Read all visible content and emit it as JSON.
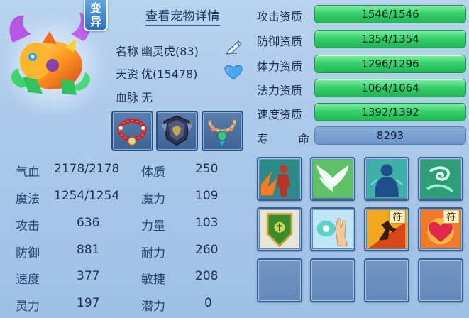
{
  "pet": {
    "variant_badge": [
      "变",
      "异"
    ],
    "detail_link": "查看宠物详情",
    "name_label": "名称",
    "name_value": "幽灵虎(83)",
    "talent_label": "天资",
    "talent_value": "优(15478)",
    "bloodline_label": "血脉",
    "bloodline_value": "无"
  },
  "equipment": [
    {
      "icon": "red-bead-collar-icon"
    },
    {
      "icon": "dark-armor-icon"
    },
    {
      "icon": "jade-necklace-icon"
    }
  ],
  "stats": {
    "hp_label": "气血",
    "hp_value": "2178/2178",
    "mp_label": "魔法",
    "mp_value": "1254/1254",
    "atk_label": "攻击",
    "atk_value": "636",
    "def_label": "防御",
    "def_value": "881",
    "spd_label": "速度",
    "spd_value": "377",
    "spi_label": "灵力",
    "spi_value": "197",
    "con_label": "体质",
    "con_value": "250",
    "mag_label": "魔力",
    "mag_value": "109",
    "str_label": "力量",
    "str_value": "103",
    "end_label": "耐力",
    "end_value": "260",
    "agi_label": "敏捷",
    "agi_value": "208",
    "pot_label": "潜力",
    "pot_value": "0"
  },
  "aptitudes": [
    {
      "label": "攻击资质",
      "value": "1546/1546",
      "fill": 1.0
    },
    {
      "label": "防御资质",
      "value": "1354/1354",
      "fill": 1.0
    },
    {
      "label": "体力资质",
      "value": "1296/1296",
      "fill": 1.0
    },
    {
      "label": "法力资质",
      "value": "1064/1064",
      "fill": 1.0
    },
    {
      "label": "速度资质",
      "value": "1392/1392",
      "fill": 1.0
    }
  ],
  "life": {
    "label_1": "寿",
    "label_2": "命",
    "value": "8293"
  },
  "skills": [
    {
      "icon": "body-flames-skill-icon"
    },
    {
      "icon": "wings-skill-icon"
    },
    {
      "icon": "shadow-figure-skill-icon"
    },
    {
      "icon": "green-swirl-skill-icon"
    },
    {
      "icon": "shield-emblem-skill-icon"
    },
    {
      "icon": "palm-orb-skill-icon"
    },
    {
      "icon": "talisman-runner-skill-icon",
      "tag": "符"
    },
    {
      "icon": "talisman-heart-skill-icon",
      "tag": "符"
    },
    {
      "icon": "empty-slot"
    },
    {
      "icon": "empty-slot"
    },
    {
      "icon": "empty-slot"
    },
    {
      "icon": "empty-slot"
    }
  ],
  "colors": {
    "background": "#aec9ea",
    "aptitude_bar": "#39d06c",
    "life_bar": "#7aa0d2",
    "text": "#1d2f4e"
  }
}
